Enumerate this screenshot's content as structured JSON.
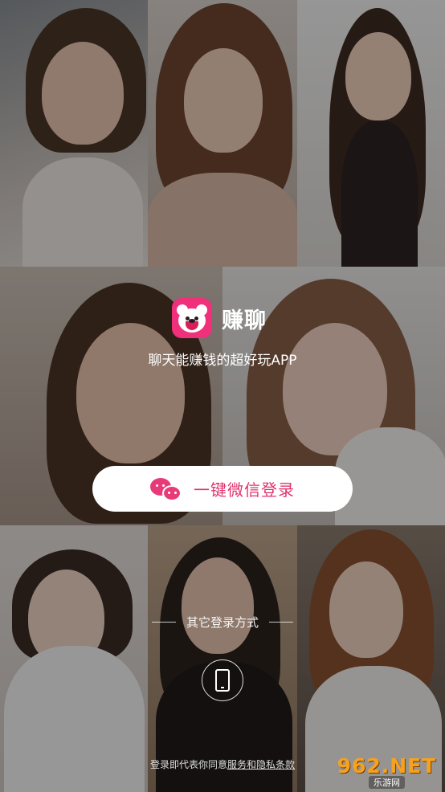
{
  "app": {
    "name": "赚聊",
    "tagline": "聊天能赚钱的超好玩APP",
    "logo_icon": "bear-logo-icon",
    "brand_color": "#f0307a"
  },
  "login": {
    "wechat_label": "一键微信登录",
    "wechat_icon": "wechat-icon",
    "other_methods_label": "其它登录方式",
    "phone_icon": "phone-icon"
  },
  "agreement": {
    "prefix": "登录即代表你同意",
    "link": "服务和隐私条款"
  },
  "watermark": {
    "main": "962.NET",
    "sub": "乐游网"
  }
}
